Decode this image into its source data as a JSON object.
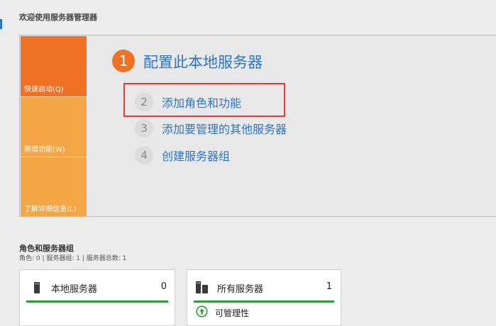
{
  "welcome": {
    "title": "欢迎使用服务器管理器",
    "tiles": [
      {
        "label": "快速启动(Q)"
      },
      {
        "label": "新增功能(W)"
      },
      {
        "label": "了解详细信息(L)"
      }
    ],
    "main_step": {
      "number": "1",
      "label": "配置此本地服务器"
    },
    "steps": [
      {
        "number": "2",
        "label": "添加角色和功能"
      },
      {
        "number": "3",
        "label": "添加要管理的其他服务器"
      },
      {
        "number": "4",
        "label": "创建服务器组"
      }
    ]
  },
  "roles": {
    "title": "角色和服务器组",
    "summary": "角色: 0 | 服务器组: 1 | 服务器总数: 1",
    "cards": [
      {
        "title": "本地服务器",
        "count": "0",
        "icon": "server-icon"
      },
      {
        "title": "所有服务器",
        "count": "1",
        "icon": "servers-icon",
        "status_label": "可管理性",
        "status_icon": "up-arrow-circle-icon"
      }
    ]
  },
  "colors": {
    "accent_orange": "#f07124",
    "tile_light": "#f4a546",
    "link_blue": "#2b75c9",
    "status_green": "#2e9c3a",
    "highlight_red": "#e03a3a"
  }
}
